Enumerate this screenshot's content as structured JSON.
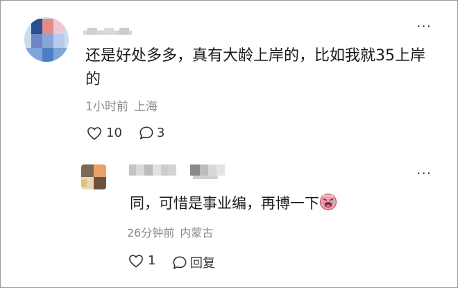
{
  "comments": [
    {
      "text": "还是好处多多，真有大龄上岸的，比如我就35上岸的",
      "time": "1小时前",
      "location": "上海",
      "likes": "10",
      "replies": "3",
      "more_icon": "more-dots-icon"
    },
    {
      "text": "同，可惜是事业编，再博一下",
      "time": "26分钟前",
      "location": "内蒙古",
      "likes": "1",
      "reply_label": "回复",
      "emoji": "crying-face-emoji",
      "more_icon": "more-dots-icon"
    }
  ]
}
